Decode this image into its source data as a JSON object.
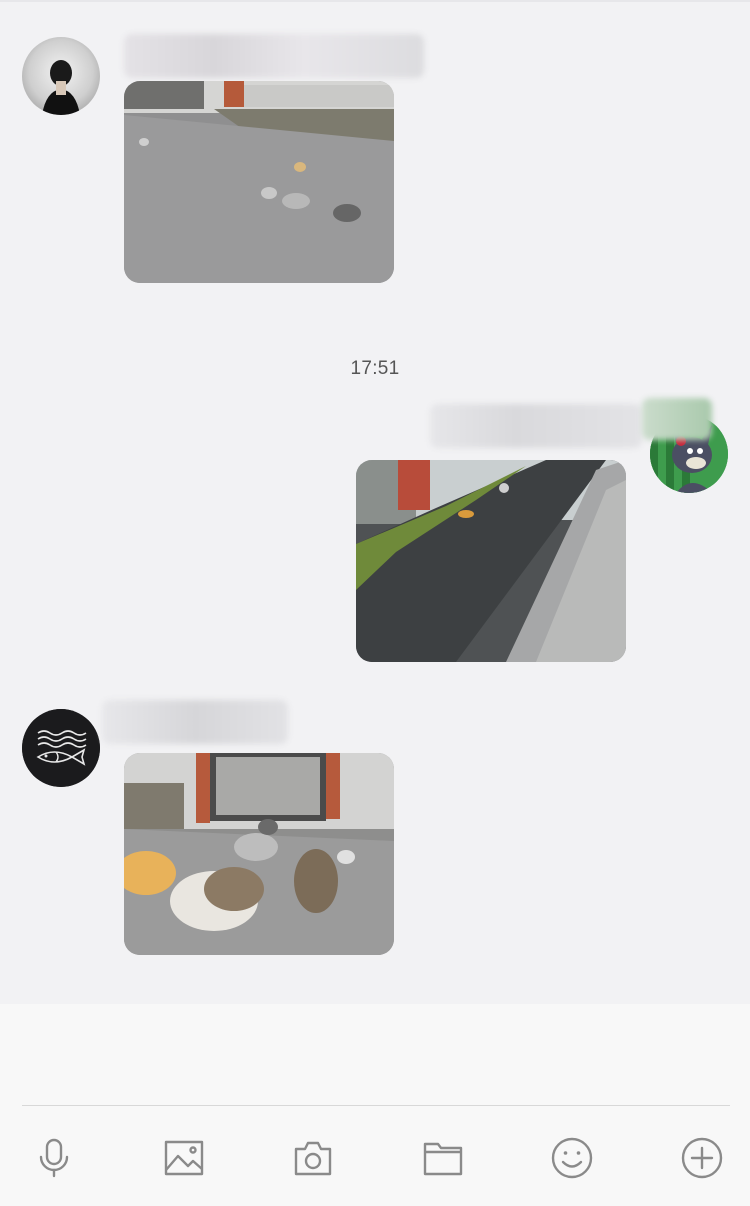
{
  "chat": {
    "timestamp": "17:51",
    "messages": [
      {
        "side": "left",
        "type": "image",
        "avatar": "person-photo-avatar",
        "content": "photo-cats-on-pavement"
      },
      {
        "side": "right",
        "type": "image",
        "avatar": "cartoon-cat-avatar",
        "content": "photo-path-with-cat"
      },
      {
        "side": "left",
        "type": "image",
        "avatar": "fish-logo-avatar",
        "content": "photo-group-of-cats"
      }
    ]
  },
  "toolbar": {
    "icons": [
      "microphone-icon",
      "image-icon",
      "camera-icon",
      "folder-icon",
      "emoji-icon",
      "plus-icon"
    ]
  },
  "colors": {
    "background": "#f2f2f4",
    "input_area": "#f8f8f8",
    "icon_gray": "#888888"
  }
}
